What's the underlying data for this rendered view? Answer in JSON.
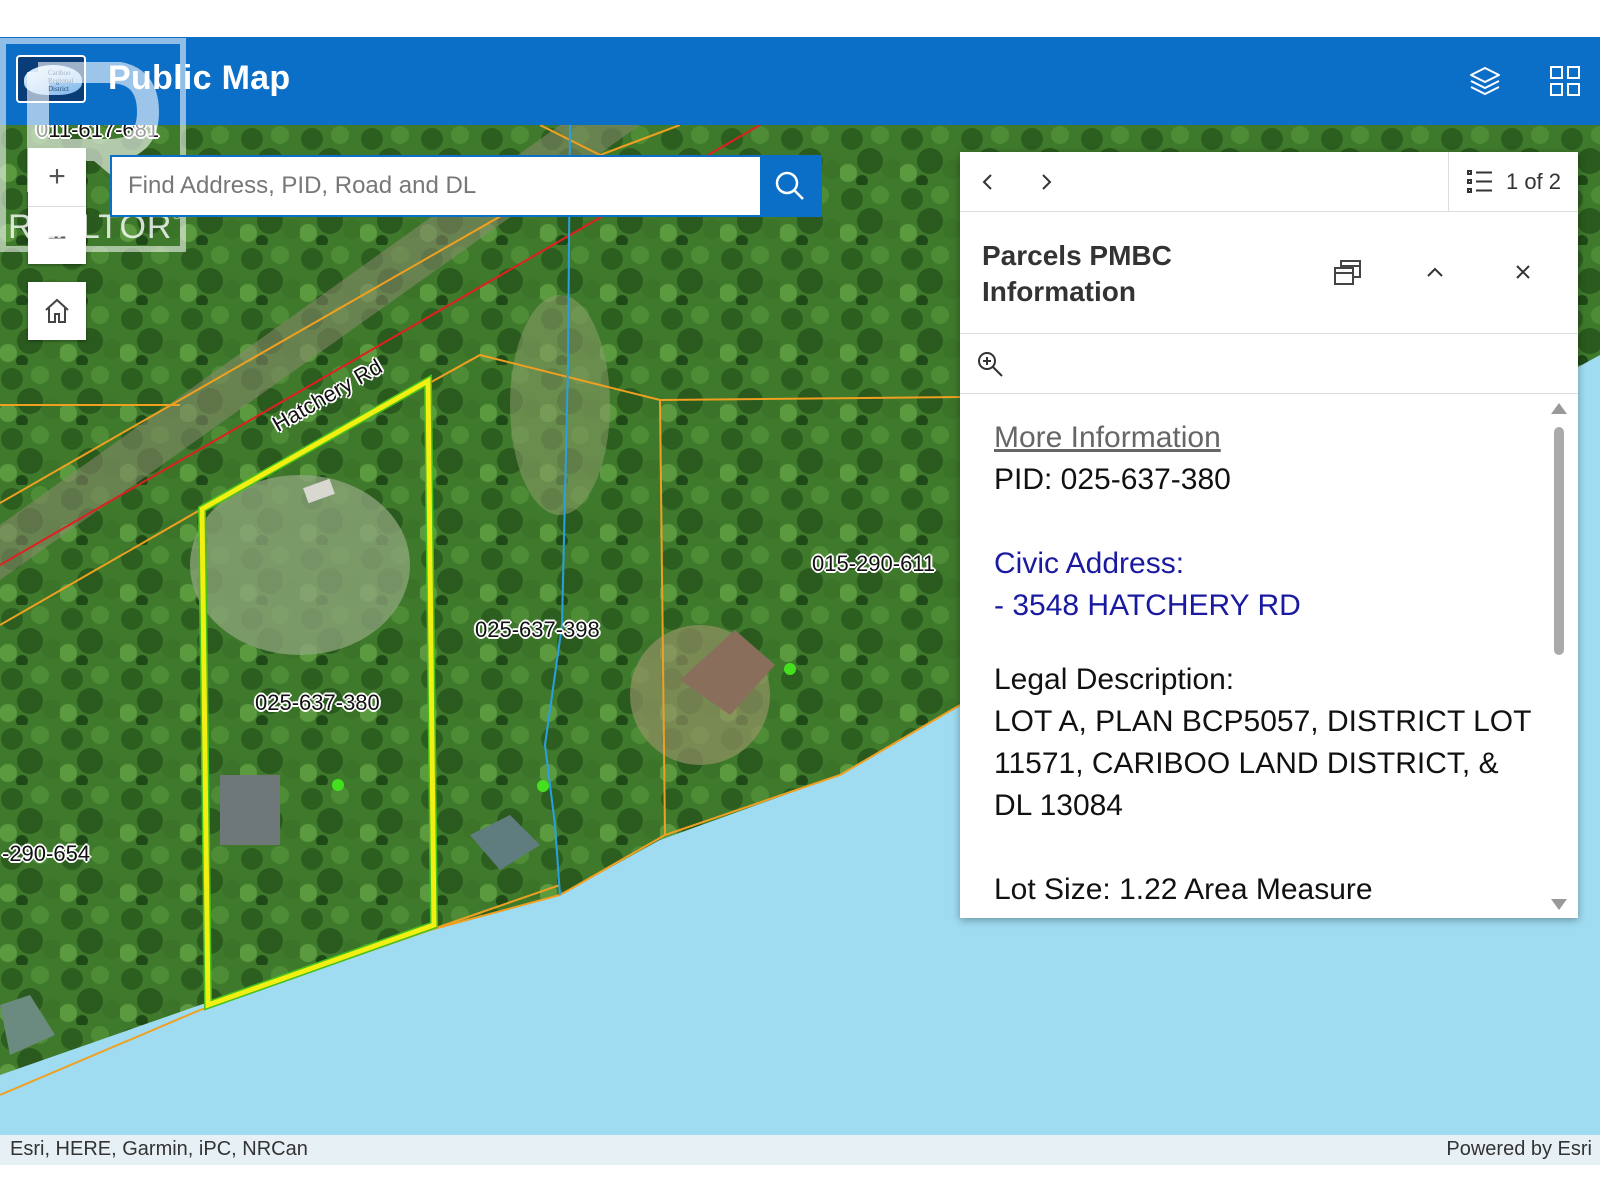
{
  "header": {
    "title": "Public Map",
    "logo_text": [
      "Cariboo",
      "Regional",
      "District"
    ]
  },
  "watermark": {
    "text": "REALTOR",
    "mark": "®"
  },
  "search": {
    "placeholder": "Find Address, PID, Road and DL"
  },
  "map": {
    "road_label": "Hatchery Rd",
    "parcel_labels": [
      "025-637-380",
      "025-637-398",
      "015-290-611",
      "-290-654",
      "011-617-681"
    ]
  },
  "controls": {
    "zoom_in": "+",
    "zoom_out": "–"
  },
  "popup": {
    "pager": "1 of 2",
    "title": "Parcels PMBC Information",
    "more_info": "More Information",
    "pid": "PID: 025-637-380",
    "civic_label": "Civic Address:",
    "civic_value": "- 3548 HATCHERY RD",
    "legal_label": "Legal Description:",
    "legal_value": "LOT A, PLAN BCP5057, DISTRICT LOT 11571, CARIBOO LAND DISTRICT, & DL 13084",
    "lot_size": "Lot Size: 1.22 Area Measure"
  },
  "attribution": {
    "left": "Esri, HERE, Garmin, iPC, NRCan",
    "right": "Powered by Esri"
  },
  "colors": {
    "header": "#0b6fc8",
    "water": "#9fdcf2",
    "selected_parcel": "#f2ef12",
    "parcel_line": "#f0a020",
    "road_line": "#e0201e",
    "stream": "#2aa0e0"
  }
}
